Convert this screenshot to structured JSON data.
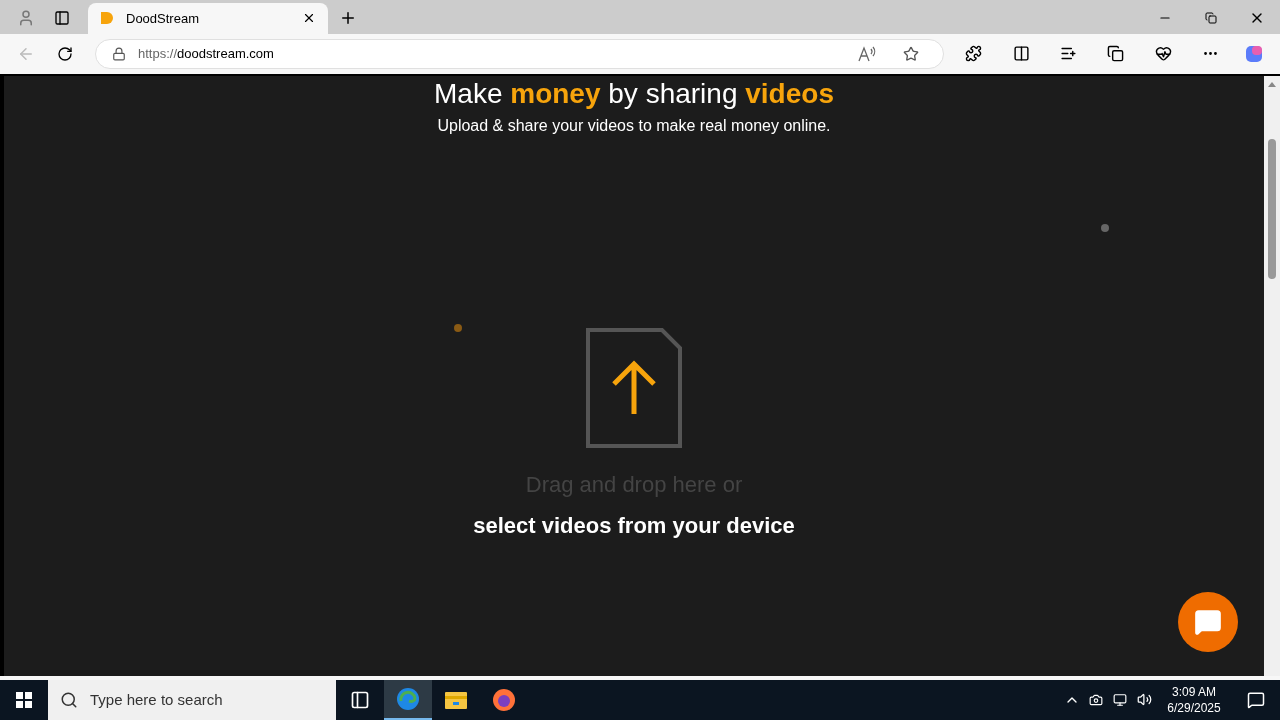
{
  "browser": {
    "tab": {
      "title": "DoodStream",
      "selected": true
    },
    "url_scheme": "https://",
    "url_host": "doodstream.com"
  },
  "page": {
    "headline": [
      {
        "text": "Make ",
        "highlight": false
      },
      {
        "text": "money",
        "highlight": true
      },
      {
        "text": " by sharing ",
        "highlight": false
      },
      {
        "text": "videos",
        "highlight": true
      }
    ],
    "subtitle": "Upload & share your videos to make real money online.",
    "drop_hint": "Drag and drop here or",
    "select_link": "select videos from your device"
  },
  "taskbar": {
    "search_placeholder": "Type here to search",
    "time": "3:09 AM",
    "date": "6/29/2025",
    "apps": [
      {
        "kind": "taskview",
        "selected": false
      },
      {
        "kind": "edge",
        "selected": true
      },
      {
        "kind": "explorer",
        "selected": false
      },
      {
        "kind": "firefox",
        "selected": false
      }
    ]
  }
}
